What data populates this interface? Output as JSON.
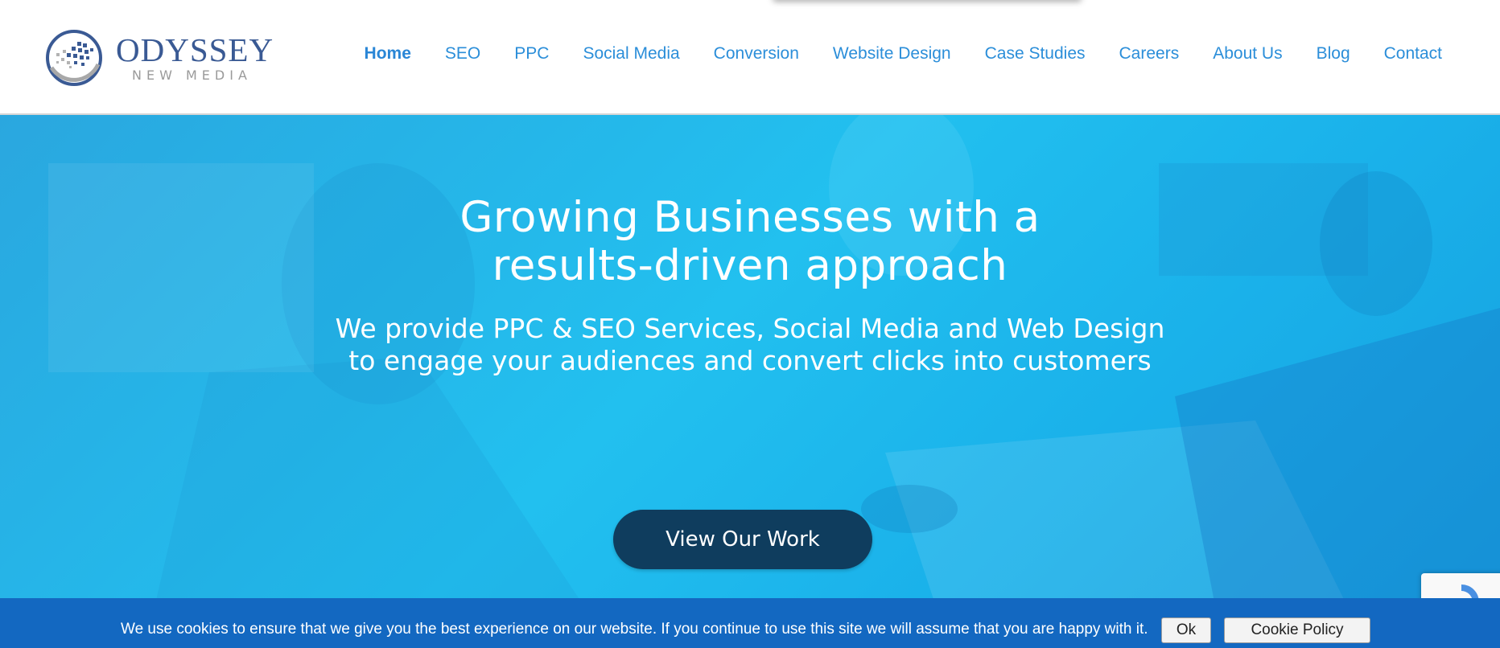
{
  "brand": {
    "name": "ODYSSEY",
    "tagline": "NEW MEDIA",
    "primary_color": "#3a5a94",
    "link_color": "#2b8ed9"
  },
  "nav": {
    "items": [
      {
        "label": "Home",
        "active": true
      },
      {
        "label": "SEO"
      },
      {
        "label": "PPC"
      },
      {
        "label": "Social Media"
      },
      {
        "label": "Conversion"
      },
      {
        "label": "Website Design"
      },
      {
        "label": "Case Studies"
      },
      {
        "label": "Careers"
      },
      {
        "label": "About Us"
      },
      {
        "label": "Blog"
      },
      {
        "label": "Contact"
      }
    ]
  },
  "hero": {
    "title_line1": "Growing Businesses with a",
    "title_line2": "results-driven approach",
    "subtitle_line1": "We provide PPC & SEO Services, Social Media and Web Design",
    "subtitle_line2": "to engage your audiences and convert clicks into customers",
    "cta_label": "View Our Work",
    "background_color": "#22b4ea",
    "cta_color": "#0f3d5e"
  },
  "cookie": {
    "message": "We use cookies to ensure that we give you the best experience on our website. If you continue to use this site we will assume that you are happy with it.",
    "ok_label": "Ok",
    "policy_label": "Cookie Policy",
    "bar_color": "#1368c1"
  },
  "icons": {
    "logo": "globe-logo-icon",
    "recaptcha": "recaptcha-icon"
  }
}
